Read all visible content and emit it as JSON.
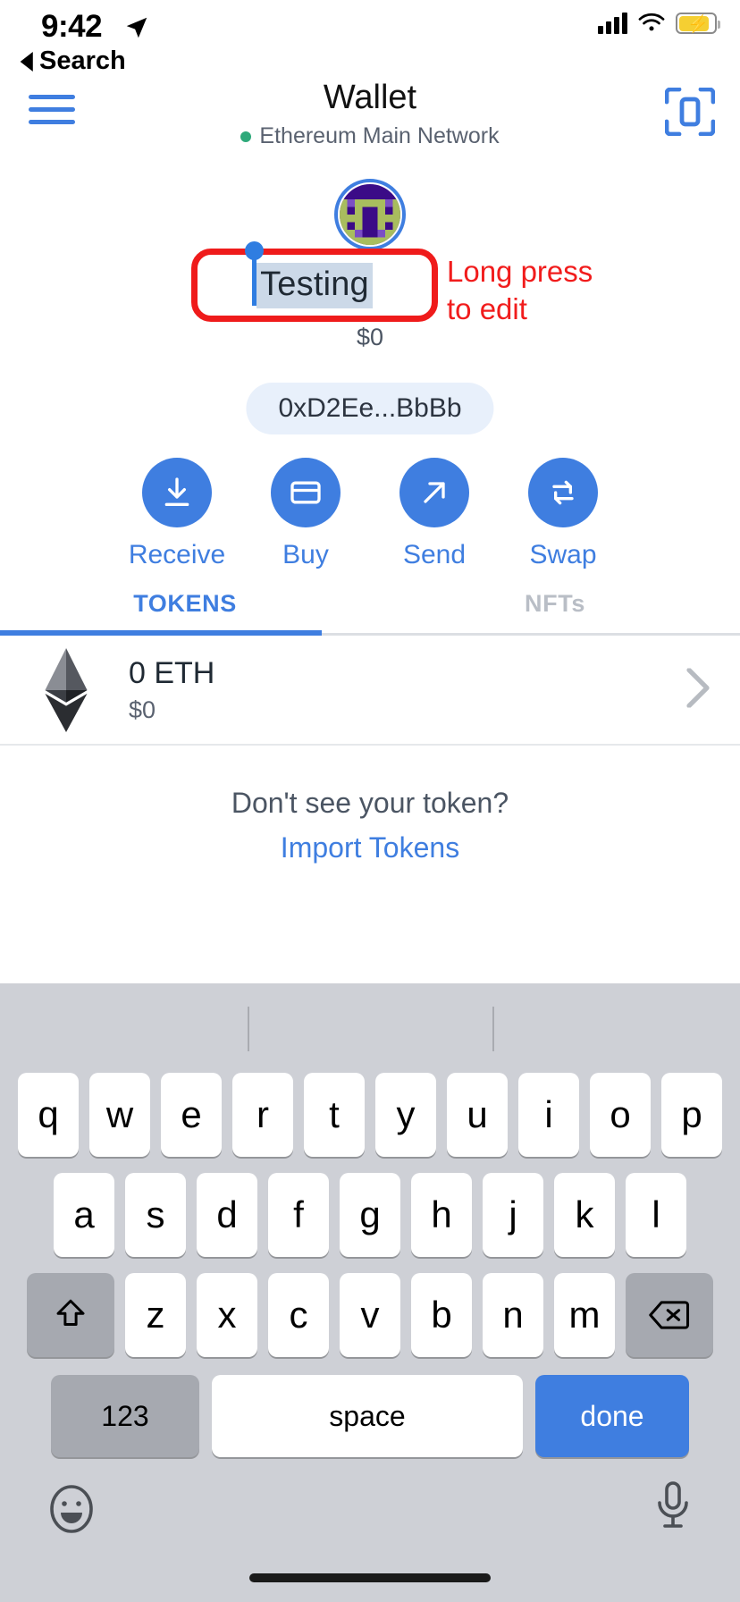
{
  "status_bar": {
    "time": "9:42",
    "location_icon": "location-arrow-icon",
    "cellular_icon": "cellular-bars-icon",
    "wifi_icon": "wifi-icon",
    "battery_icon": "battery-charging-icon"
  },
  "back_link": {
    "label": "Search",
    "icon": "back-triangle-icon"
  },
  "nav": {
    "menu_icon": "hamburger-menu-icon",
    "title": "Wallet",
    "network": "Ethereum Main Network",
    "network_status_color": "#2ea97a",
    "scan_icon": "scan-qr-icon"
  },
  "account": {
    "avatar_icon": "identicon-avatar",
    "name_value": "Testing",
    "name_selected": true,
    "fiat_balance": "$0",
    "address": "0xD2Ee...BbBb"
  },
  "annotation": {
    "line1": "Long press",
    "line2": "to edit",
    "color": "#f11c1c"
  },
  "actions": [
    {
      "label": "Receive",
      "icon": "download-arrow-icon"
    },
    {
      "label": "Buy",
      "icon": "credit-card-icon"
    },
    {
      "label": "Send",
      "icon": "arrow-up-right-icon"
    },
    {
      "label": "Swap",
      "icon": "swap-arrows-icon"
    }
  ],
  "tabs": [
    {
      "label": "TOKENS",
      "active": true
    },
    {
      "label": "NFTs",
      "active": false
    }
  ],
  "tokens": [
    {
      "icon": "ethereum-diamond-icon",
      "amount": "0 ETH",
      "fiat": "$0",
      "chevron": "chevron-right-icon"
    }
  ],
  "import": {
    "question": "Don't see your token?",
    "link": "Import Tokens"
  },
  "keyboard": {
    "predictions": [
      "",
      "",
      ""
    ],
    "row1": [
      "q",
      "w",
      "e",
      "r",
      "t",
      "y",
      "u",
      "i",
      "o",
      "p"
    ],
    "row2": [
      "a",
      "s",
      "d",
      "f",
      "g",
      "h",
      "j",
      "k",
      "l"
    ],
    "row3": [
      "z",
      "x",
      "c",
      "v",
      "b",
      "n",
      "m"
    ],
    "shift_icon": "shift-up-arrow-icon",
    "backspace_icon": "backspace-delete-icon",
    "numbers_label": "123",
    "space_label": "space",
    "done_label": "done",
    "emoji_icon": "emoji-smiley-icon",
    "mic_icon": "microphone-icon"
  },
  "colors": {
    "accent_blue": "#3f7ee0",
    "annotation_red": "#f11c1c",
    "keyboard_bg": "#ced0d6",
    "selection_blue": "#ccd9e8"
  }
}
